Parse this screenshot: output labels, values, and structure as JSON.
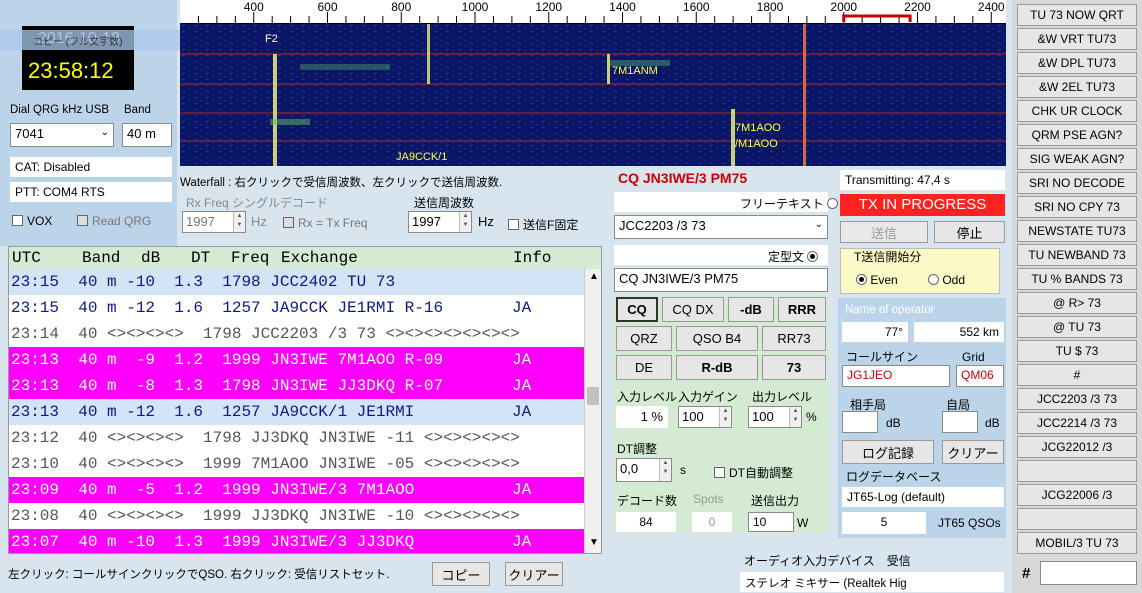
{
  "clock": {
    "date": "2016-10-18",
    "time": "23:58:12",
    "caption": "コピー (フル文字数)"
  },
  "waterfall": {
    "axis_ticks": [
      "400",
      "600",
      "800",
      "1000",
      "1200",
      "1400",
      "1600",
      "1800",
      "2000",
      "2200",
      "2400"
    ],
    "f2_label": "F2",
    "signals": [
      "7M1ANM",
      "7M1AOO",
      "/M1AOO",
      "JA9CCK/1"
    ],
    "hint": "Waterfall : 右クリックで受信周波数、左クリックで送信周波数."
  },
  "freq": {
    "dial_label": "Dial QRG kHz USB",
    "band_label": "Band",
    "dial_value": "7041",
    "band_value": "40 m"
  },
  "cat": {
    "status": "CAT: Disabled",
    "ptt": "PTT: COM4 RTS",
    "vox": "VOX",
    "read_qrg": "Read QRG"
  },
  "rx": {
    "label": "Rx Freq シングルデコード",
    "value": "1997",
    "unit": "Hz",
    "rx_eq_tx": "Rx = Tx Freq"
  },
  "tx": {
    "label": "送信周波数",
    "value": "1997",
    "unit": "Hz",
    "fixed": "送信F固定"
  },
  "table": {
    "headers": {
      "utc": "UTC",
      "band": "Band",
      "db": "dB",
      "dt": "DT",
      "freq": "Freq",
      "exchange": "Exchange",
      "info": "Info"
    },
    "rows": [
      {
        "text": "23:15  40 m -10  1.3  1798 JCC2402 TU 73",
        "info": "",
        "style": "blue"
      },
      {
        "text": "23:15  40 m -12  1.6  1257 JA9CCK JE1RMI R-16",
        "info": "JA",
        "style": "white-blue"
      },
      {
        "text": "23:14  40 <><><><>  1798 JCC2203 /3 73 <><><><><><><>",
        "info": "",
        "style": "gray"
      },
      {
        "text": "23:13  40 m  -9  1.2  1999 JN3IWE 7M1AOO R-09",
        "info": "JA",
        "style": "magenta"
      },
      {
        "text": "23:13  40 m  -8  1.3  1798 JN3IWE JJ3DKQ R-07",
        "info": "JA",
        "style": "magenta"
      },
      {
        "text": "23:13  40 m -12  1.6  1257 JA9CCK/1 JE1RMI",
        "info": "JA",
        "style": "blue"
      },
      {
        "text": "23:12  40 <><><><>  1798 JJ3DKQ JN3IWE -11 <><><><><>",
        "info": "",
        "style": "gray"
      },
      {
        "text": "23:10  40 <><><><>  1999 7M1AOO JN3IWE -05 <><><><><>",
        "info": "",
        "style": "gray"
      },
      {
        "text": "23:09  40 m  -5  1.2  1999 JN3IWE/3 7M1AOO",
        "info": "JA",
        "style": "magenta"
      },
      {
        "text": "23:08  40 <><><><>  1999 JJ3DKQ JN3IWE -10 <><><><><>",
        "info": "",
        "style": "gray"
      },
      {
        "text": "23:07  40 m -10  1.3  1999 JN3IWE/3 JJ3DKQ",
        "info": "JA",
        "style": "magenta"
      }
    ],
    "footer": "左クリック: コールサインクリックでQSO. 右クリック: 受信リストセット.",
    "copy_btn": "コピー",
    "clear_btn": "クリアー"
  },
  "middle": {
    "cq_title": "CQ JN3IWE/3 PM75",
    "free_text_label": "フリーテキスト",
    "free_text_value": "JCC2203 /3 73",
    "fixed_text_label": "定型文",
    "fixed_text_value": "CQ JN3IWE/3 PM75",
    "buttons": [
      "CQ",
      "CQ DX",
      "-dB",
      "RRR",
      "QRZ",
      "QSO B4",
      "RR73",
      "DE",
      "R-dB",
      "73"
    ],
    "input_level_label": "入力レベル",
    "input_level_value": "1 %",
    "input_gain_label": "入力ゲイン",
    "input_gain_value": "100",
    "output_level_label": "出力レベル",
    "output_level_value": "100",
    "output_level_unit": "%",
    "dt_adjust_label": "DT調整",
    "dt_adjust_value": "0,0",
    "dt_unit": "s",
    "dt_auto": "DT自動調整",
    "decode_count_label": "デコード数",
    "decode_count_value": "84",
    "spots_label": "Spots",
    "spots_value": "0",
    "tx_power_label": "送信出力",
    "tx_power_value": "10",
    "tx_power_unit": "W"
  },
  "right": {
    "transmitting": "Transmitting: 47,4 s",
    "tx_in_progress": "TX IN PROGRESS",
    "send_btn": "送信",
    "stop_btn": "停止",
    "tx_start_label": "T送信開始分",
    "even": "Even",
    "odd": "Odd",
    "operator_label": "Name of operator",
    "azimuth": "77°",
    "distance": "552 km",
    "callsign_label": "コールサイン",
    "grid_label": "Grid",
    "callsign_value": "JG1JEO",
    "grid_value": "QM06",
    "their_label": "相手局",
    "my_label": "自局",
    "db_unit": "dB",
    "log_btn": "ログ記録",
    "clear_btn": "クリアー",
    "logdb_label": "ログデータベース",
    "logdb_value": "JT65-Log (default)",
    "qso_count": "5",
    "qso_label": "JT65 QSOs",
    "audio_label": "オーディオ入力デバイス　受信",
    "audio_value": "ステレオ ミキサー (Realtek Hig"
  },
  "macros": [
    "TU 73 NOW QRT",
    "&W VRT TU73",
    "&W DPL TU73",
    "&W 2EL TU73",
    "CHK UR CLOCK",
    "QRM PSE AGN?",
    "SIG WEAK AGN?",
    "SRI NO DECODE",
    "SRI NO CPY 73",
    "NEWSTATE TU73",
    "TU NEWBAND 73",
    "TU % BANDS 73",
    "@ R> 73",
    "@ TU 73",
    "TU $ 73",
    "#",
    "JCC2203 /3 73",
    "JCC2214 /3 73",
    "JCG22012 /3",
    "",
    "JCG22006 /3",
    "",
    "MOBIL/3 TU 73"
  ],
  "macro_input_label": "#",
  "colors": {
    "accent_red": "#cc0000",
    "tx_bg": "#ff2222",
    "magenta": "#ff00ff",
    "row_blue": "#d2e4f5",
    "waterfall": "#0a1560",
    "green_panel": "#d4ead2"
  }
}
